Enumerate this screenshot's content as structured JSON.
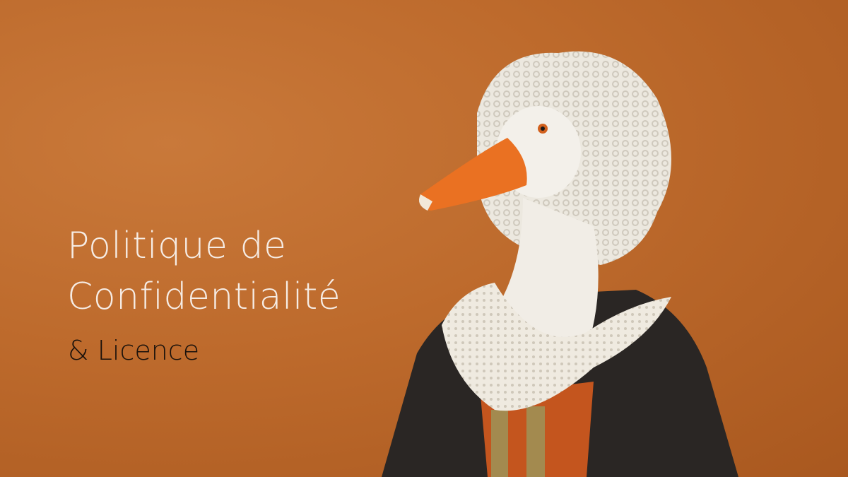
{
  "heading": {
    "line1": "Politique de",
    "line2": "Confidentialité",
    "subtitle": "& Licence"
  },
  "colors": {
    "background": "#bd6a2c",
    "title_text": "#f6ece4",
    "subtitle_text": "#1a120c"
  }
}
